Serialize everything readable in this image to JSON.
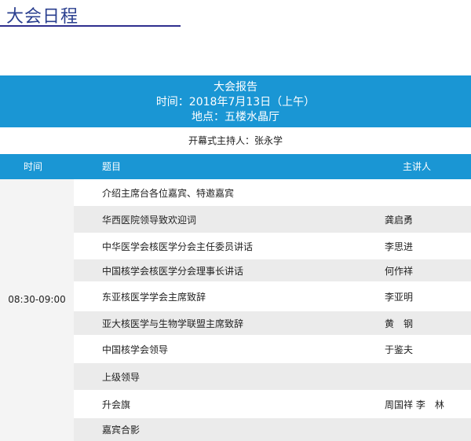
{
  "page_title": "大会日程",
  "banner": {
    "line1": "大会报告",
    "line2": "时间：2018年7月13日（上午）",
    "line3": "地点：五楼水晶厅"
  },
  "host_line": "开幕式主持人：张永学",
  "table": {
    "headers": {
      "time": "时间",
      "topic": "题目",
      "speaker": "主讲人"
    },
    "time_slot": "08:30-09:00",
    "rows": [
      {
        "topic": "介绍主席台各位嘉宾、特邀嘉宾",
        "speaker": ""
      },
      {
        "topic": "华西医院领导致欢迎词",
        "speaker": "龚启勇"
      },
      {
        "topic": "中华医学会核医学分会主任委员讲话",
        "speaker": "李思进"
      },
      {
        "topic": "中国核学会核医学分会理事长讲话",
        "speaker": "何作祥"
      },
      {
        "topic": "东亚核医学学会主席致辞",
        "speaker": "李亚明"
      },
      {
        "topic": "亚大核医学与生物学联盟主席致辞",
        "speaker": "黄　钢"
      },
      {
        "topic": "中国核学会领导",
        "speaker": "于鉴夫"
      },
      {
        "topic": "上级领导",
        "speaker": ""
      },
      {
        "topic": "升会旗",
        "speaker": "周国祥  李　林"
      },
      {
        "topic": "嘉宾合影",
        "speaker": ""
      }
    ]
  },
  "colors": {
    "accent": "#1a96d4",
    "title": "#2a3f8f",
    "alt_row": "#ebebeb"
  }
}
